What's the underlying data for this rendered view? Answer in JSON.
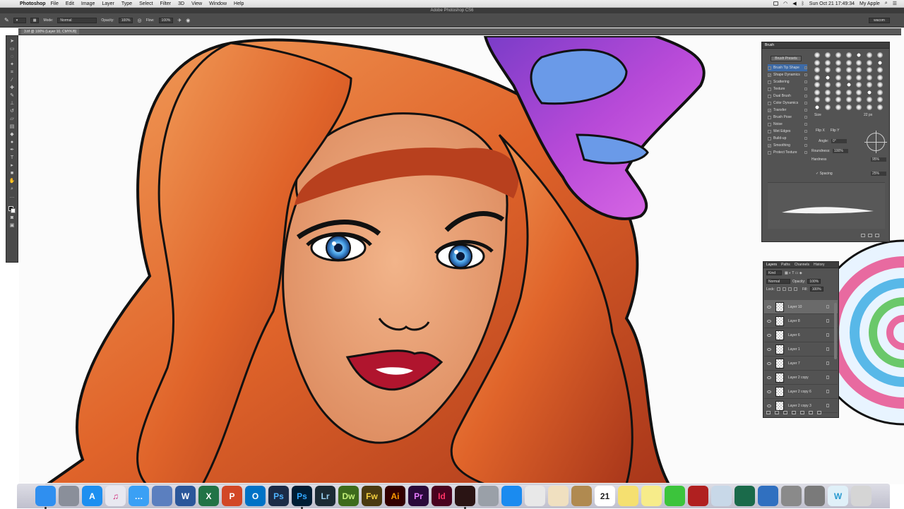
{
  "menubar": {
    "app_name": "Photoshop",
    "menus": [
      "File",
      "Edit",
      "Image",
      "Layer",
      "Type",
      "Select",
      "Filter",
      "3D",
      "View",
      "Window",
      "Help"
    ],
    "clock": "Sun Oct 21  17:49:34",
    "user": "My Apple"
  },
  "window_title": "Adobe Photoshop CS6",
  "options_bar": {
    "mode_label": "Mode:",
    "mode_value": "Normal",
    "opacity_label": "Opacity:",
    "opacity_value": "100%",
    "flow_label": "Flow:",
    "flow_value": "100%",
    "workspace": "wacom"
  },
  "document_tab": "3.tif @ 100% (Layer 10, CMYK/8)",
  "brush_panel": {
    "tabs": [
      "Brush"
    ],
    "presets_button": "Brush Presets",
    "settings": [
      {
        "label": "Brush Tip Shape",
        "checked": false,
        "selected": true
      },
      {
        "label": "Shape Dynamics",
        "checked": true,
        "selected": false
      },
      {
        "label": "Scattering",
        "checked": false,
        "selected": false
      },
      {
        "label": "Texture",
        "checked": false,
        "selected": false
      },
      {
        "label": "Dual Brush",
        "checked": false,
        "selected": false
      },
      {
        "label": "Color Dynamics",
        "checked": false,
        "selected": false
      },
      {
        "label": "Transfer",
        "checked": true,
        "selected": false
      },
      {
        "label": "Brush Pose",
        "checked": false,
        "selected": false
      },
      {
        "label": "Noise",
        "checked": false,
        "selected": false
      },
      {
        "label": "Wet Edges",
        "checked": false,
        "selected": false
      },
      {
        "label": "Build-up",
        "checked": false,
        "selected": false
      },
      {
        "label": "Smoothing",
        "checked": true,
        "selected": false
      },
      {
        "label": "Protect Texture",
        "checked": false,
        "selected": false
      }
    ],
    "size_label": "Size",
    "size_value": "22 px",
    "flip_x": "Flip X",
    "flip_y": "Flip Y",
    "angle_label": "Angle:",
    "angle_value": "0°",
    "roundness_label": "Roundness:",
    "roundness_value": "100%",
    "hardness_label": "Hardness",
    "hardness_value": "95%",
    "spacing_label": "Spacing",
    "spacing_value": "25%"
  },
  "layers_panel": {
    "tabs": [
      "Layers",
      "Paths",
      "Channels",
      "History"
    ],
    "kind_label": "Kind",
    "blend_mode": "Normal",
    "opacity_label": "Opacity:",
    "opacity_value": "100%",
    "lock_label": "Lock:",
    "fill_label": "Fill:",
    "fill_value": "100%",
    "layers": [
      {
        "name": "Layer 10",
        "selected": true
      },
      {
        "name": "Layer 8",
        "selected": false
      },
      {
        "name": "Layer 6",
        "selected": false
      },
      {
        "name": "Layer 1",
        "selected": false
      },
      {
        "name": "Layer 7",
        "selected": false
      },
      {
        "name": "Layer 2 copy",
        "selected": false
      },
      {
        "name": "Layer 2 copy 6",
        "selected": false
      },
      {
        "name": "Layer 2 copy 3",
        "selected": false
      }
    ]
  },
  "dock": {
    "apps": [
      {
        "name": "Finder",
        "label": "",
        "bg": "#2f8ff0",
        "fg": "#ffffff",
        "icon": "finder-icon"
      },
      {
        "name": "Launchpad",
        "label": "",
        "bg": "#8a8f9a",
        "fg": "#ffffff",
        "icon": "rocket-icon"
      },
      {
        "name": "App Store",
        "label": "A",
        "bg": "#1d8ff0",
        "fg": "#ffffff",
        "icon": "app-store-icon"
      },
      {
        "name": "iTunes",
        "label": "♫",
        "bg": "#e8e8f0",
        "fg": "#d02a7a",
        "icon": "music-icon"
      },
      {
        "name": "Messages",
        "label": "…",
        "bg": "#3aa0f5",
        "fg": "#ffffff",
        "icon": "messages-icon"
      },
      {
        "name": "Preview",
        "label": "",
        "bg": "#5b7fbf",
        "fg": "#ffffff",
        "icon": "preview-icon"
      },
      {
        "name": "Word",
        "label": "W",
        "bg": "#2b579a",
        "fg": "#ffffff",
        "icon": "word-icon"
      },
      {
        "name": "Excel",
        "label": "X",
        "bg": "#217346",
        "fg": "#ffffff",
        "icon": "excel-icon"
      },
      {
        "name": "PowerPoint",
        "label": "P",
        "bg": "#d24726",
        "fg": "#ffffff",
        "icon": "powerpoint-icon"
      },
      {
        "name": "Outlook",
        "label": "O",
        "bg": "#0072c6",
        "fg": "#ffffff",
        "icon": "outlook-icon"
      },
      {
        "name": "Photoshop CS6",
        "label": "Ps",
        "bg": "#1b2b47",
        "fg": "#4fb3ff",
        "icon": "photoshop-icon"
      },
      {
        "name": "Photoshop CC",
        "label": "Ps",
        "bg": "#001d34",
        "fg": "#31a8ff",
        "icon": "photoshop-icon"
      },
      {
        "name": "Lightroom",
        "label": "Lr",
        "bg": "#1c2b34",
        "fg": "#9ad0f0",
        "icon": "lightroom-icon"
      },
      {
        "name": "Dreamweaver",
        "label": "Dw",
        "bg": "#3d6b1c",
        "fg": "#c5f07a",
        "icon": "dreamweaver-icon"
      },
      {
        "name": "Fireworks",
        "label": "Fw",
        "bg": "#4a3a10",
        "fg": "#f5d040",
        "icon": "fireworks-icon"
      },
      {
        "name": "Illustrator",
        "label": "Ai",
        "bg": "#330000",
        "fg": "#ff9a00",
        "icon": "illustrator-icon"
      },
      {
        "name": "Premiere",
        "label": "Pr",
        "bg": "#2a0a3a",
        "fg": "#e77bff",
        "icon": "premiere-icon"
      },
      {
        "name": "InDesign",
        "label": "Id",
        "bg": "#49021f",
        "fg": "#ff3366",
        "icon": "indesign-icon"
      },
      {
        "name": "Acrobat",
        "label": "",
        "bg": "#2a1414",
        "fg": "#e83030",
        "icon": "acrobat-icon"
      },
      {
        "name": "Utility",
        "label": "",
        "bg": "#9aa0a8",
        "fg": "#ffffff",
        "icon": "utility-icon"
      },
      {
        "name": "Safari",
        "label": "",
        "bg": "#1a8bf0",
        "fg": "#ffffff",
        "icon": "safari-icon"
      },
      {
        "name": "Chrome",
        "label": "",
        "bg": "#e8e8e8",
        "fg": "#d93025",
        "icon": "chrome-icon"
      },
      {
        "name": "Photos",
        "label": "",
        "bg": "#f0e0c0",
        "fg": "#e05020",
        "icon": "photos-icon"
      },
      {
        "name": "Notes Book",
        "label": "",
        "bg": "#b08a50",
        "fg": "#ffffff",
        "icon": "book-icon"
      },
      {
        "name": "Calendar",
        "label": "21",
        "bg": "#ffffff",
        "fg": "#222222",
        "icon": "calendar-icon"
      },
      {
        "name": "Stickies",
        "label": "",
        "bg": "#f5e070",
        "fg": "#555555",
        "icon": "stickies-icon"
      },
      {
        "name": "Notes",
        "label": "",
        "bg": "#f7ec8a",
        "fg": "#555555",
        "icon": "notes-icon"
      },
      {
        "name": "FaceTime",
        "label": "",
        "bg": "#3cc43c",
        "fg": "#ffffff",
        "icon": "facetime-icon"
      },
      {
        "name": "Photo Booth",
        "label": "",
        "bg": "#b02020",
        "fg": "#ffffff",
        "icon": "photo-booth-icon"
      },
      {
        "name": "Preview Images",
        "label": "",
        "bg": "#c8d8e8",
        "fg": "#555555",
        "icon": "image-icon"
      },
      {
        "name": "Time Machine",
        "label": "",
        "bg": "#1a6a4a",
        "fg": "#ffffff",
        "icon": "time-machine-icon"
      },
      {
        "name": "Migration",
        "label": "",
        "bg": "#3070c0",
        "fg": "#ffffff",
        "icon": "migration-icon"
      },
      {
        "name": "Utilities",
        "label": "",
        "bg": "#8a8a8a",
        "fg": "#ffffff",
        "icon": "tools-icon"
      },
      {
        "name": "System Preferences",
        "label": "",
        "bg": "#7a7a7a",
        "fg": "#ffffff",
        "icon": "gear-icon"
      },
      {
        "name": "Wacom",
        "label": "W",
        "bg": "#e0f0f8",
        "fg": "#2a9ad0",
        "icon": "wacom-icon"
      },
      {
        "name": "Trash",
        "label": "",
        "bg": "#d5d5d5",
        "fg": "#777777",
        "icon": "trash-icon"
      }
    ]
  }
}
